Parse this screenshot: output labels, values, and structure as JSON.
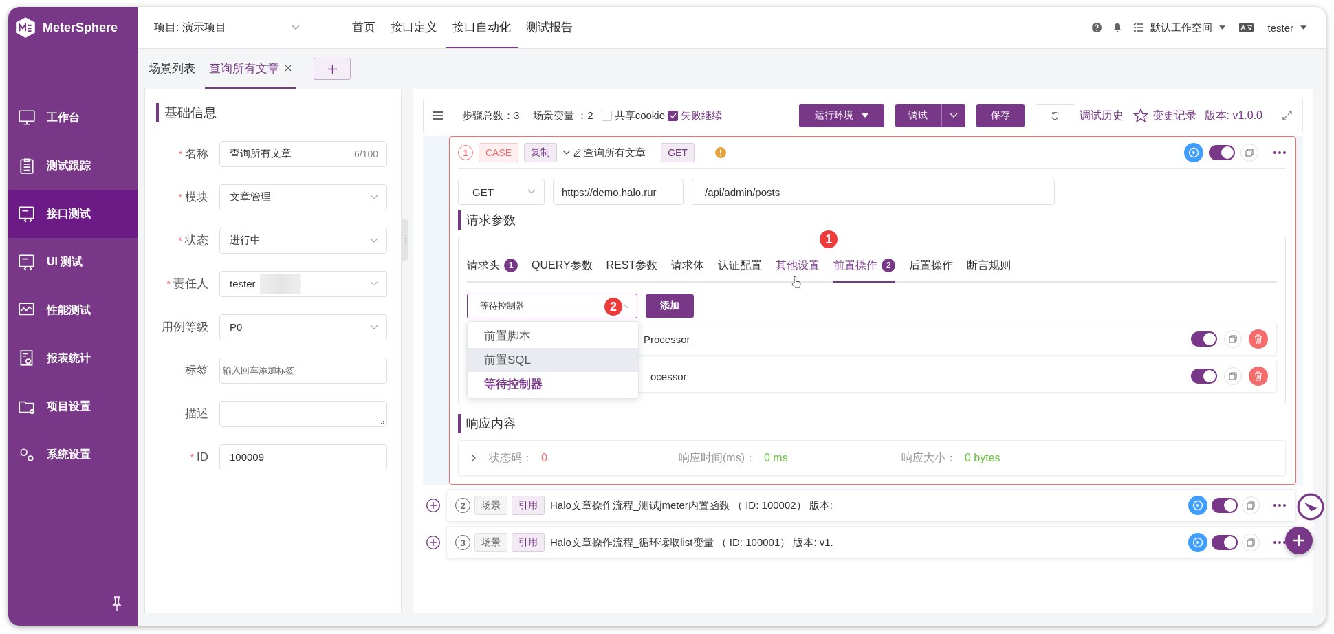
{
  "app": {
    "logo": "MeterSphere"
  },
  "sidebar": {
    "items": [
      {
        "label": "工作台",
        "selected": false
      },
      {
        "label": "测试跟踪",
        "selected": false
      },
      {
        "label": "接口测试",
        "selected": true
      },
      {
        "label": "UI 测试",
        "selected": false
      },
      {
        "label": "性能测试",
        "selected": false
      },
      {
        "label": "报表统计",
        "selected": false
      },
      {
        "label": "项目设置",
        "selected": false
      },
      {
        "label": "系统设置",
        "selected": false
      }
    ]
  },
  "header": {
    "project": "项目: 演示项目",
    "nav": [
      {
        "label": "首页",
        "selected": false
      },
      {
        "label": "接口定义",
        "selected": false
      },
      {
        "label": "接口自动化",
        "selected": true
      },
      {
        "label": "测试报告",
        "selected": false
      }
    ],
    "workspace": "默认工作空间",
    "user": "tester"
  },
  "tabs": [
    {
      "label": "场景列表",
      "selected": false,
      "closable": false
    },
    {
      "label": "查询所有文章",
      "selected": true,
      "closable": true
    }
  ],
  "basic_info": {
    "title": "基础信息",
    "required_mark": "*",
    "fields": [
      {
        "kind": "input",
        "label": "名称",
        "required": true,
        "value": "查询所有文章",
        "counter": "6/100"
      },
      {
        "kind": "select",
        "label": "模块",
        "required": true,
        "value": "文章管理"
      },
      {
        "kind": "select",
        "label": "状态",
        "required": true,
        "value": "进行中"
      },
      {
        "kind": "select",
        "label": "责任人",
        "required": true,
        "value": "tester",
        "redacted": true
      },
      {
        "kind": "select",
        "label": "用例等级",
        "required": false,
        "value": "P0"
      },
      {
        "kind": "input",
        "label": "标签",
        "required": false,
        "placeholder": "输入回车添加标签"
      },
      {
        "kind": "textarea",
        "label": "描述",
        "required": false
      },
      {
        "kind": "input",
        "label": "ID",
        "required": true,
        "value": "100009"
      }
    ]
  },
  "toolbar": {
    "steps_label": "步骤总数：",
    "steps_count": "3",
    "variables_label": "场景变量",
    "variables_count": "：2",
    "share_cookie": {
      "label": "共享cookie",
      "checked": false
    },
    "continue_on_fail": {
      "label": "失败继续",
      "checked": true
    },
    "env_button": "运行环境",
    "debug_button": "调试",
    "save_button": "保存",
    "debug_history": "调试历史",
    "change_log": "变更记录",
    "version": "版本: v1.0.0"
  },
  "steps": [
    {
      "index": "1",
      "type": "CASE",
      "tag": "复制",
      "name": "查询所有文章",
      "method": "GET",
      "warning": true,
      "enabled": true,
      "expanded": true,
      "request": {
        "method": "GET",
        "domain": "https://demo.halo.rur",
        "path": "/api/admin/posts",
        "title": "请求参数",
        "tabs": [
          {
            "label": "请求头",
            "count": "1",
            "selected": false,
            "hovered": false
          },
          {
            "label": "QUERY参数",
            "selected": false,
            "hovered": false
          },
          {
            "label": "REST参数",
            "selected": false,
            "hovered": false
          },
          {
            "label": "请求体",
            "selected": false,
            "hovered": false
          },
          {
            "label": "认证配置",
            "selected": false,
            "hovered": false
          },
          {
            "label": "其他设置",
            "selected": false,
            "hovered": true
          },
          {
            "label": "前置操作",
            "count": "2",
            "selected": true,
            "hovered": false,
            "callout": "1"
          },
          {
            "label": "后置操作",
            "selected": false,
            "hovered": false
          },
          {
            "label": "断言规则",
            "selected": false,
            "hovered": false
          }
        ],
        "processor_select": {
          "value": "等待控制器",
          "callout": "2",
          "options": [
            {
              "label": "前置脚本",
              "selected": false,
              "highlighted": false
            },
            {
              "label": "前置SQL",
              "selected": false,
              "highlighted": true
            },
            {
              "label": "等待控制器",
              "selected": true,
              "highlighted": false
            }
          ]
        },
        "add_button": "添加",
        "processors": [
          {
            "name": "Processor",
            "enabled": true
          },
          {
            "name": "ocessor",
            "enabled": true
          }
        ]
      },
      "response": {
        "title": "响应内容",
        "status_label": "状态码：",
        "status": "0",
        "time_label": "响应时间(ms)：",
        "time": "0 ms",
        "size_label": "响应大小：",
        "size": "0 bytes"
      }
    },
    {
      "index": "2",
      "type": "场景",
      "tag": "引用",
      "name": "Halo文章操作流程_测试jmeter内置函数 （ ID: 100002） 版本:",
      "enabled": true,
      "expanded": false
    },
    {
      "index": "3",
      "type": "场景",
      "tag": "引用",
      "name": "Halo文章操作流程_循环读取list变量 （ ID: 100001） 版本: v1.",
      "enabled": true,
      "expanded": false
    }
  ]
}
